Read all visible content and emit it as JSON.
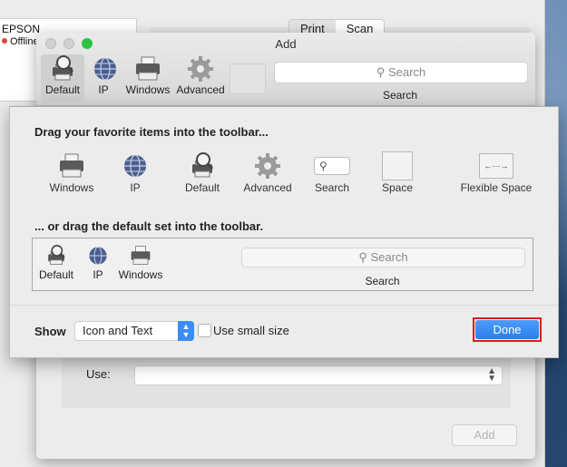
{
  "background": {
    "printer_name": "EPSON",
    "printer_status": "Offline",
    "tabs": [
      "Print",
      "Scan"
    ]
  },
  "add_window": {
    "title": "Add",
    "toolbar": [
      {
        "label": "Default",
        "icon": "default-printer-icon"
      },
      {
        "label": "IP",
        "icon": "ip-globe-icon"
      },
      {
        "label": "Windows",
        "icon": "windows-printer-icon"
      },
      {
        "label": "Advanced",
        "icon": "advanced-gear-icon"
      }
    ],
    "search_placeholder": "Search",
    "search_label": "Search",
    "use_label": "Use:",
    "add_button": "Add"
  },
  "sheet": {
    "heading_favorites": "Drag your favorite items into the toolbar...",
    "palette": [
      {
        "label": "Windows",
        "icon": "windows-printer-icon"
      },
      {
        "label": "IP",
        "icon": "ip-globe-icon"
      },
      {
        "label": "Default",
        "icon": "default-printer-icon"
      },
      {
        "label": "Advanced",
        "icon": "advanced-gear-icon"
      },
      {
        "label": "Search",
        "icon": "search-icon"
      },
      {
        "label": "Space",
        "icon": "space-icon"
      },
      {
        "label": "Flexible Space",
        "icon": "flexible-space-icon"
      }
    ],
    "heading_default": "... or drag the default set into the toolbar.",
    "default_set": [
      {
        "label": "Default",
        "icon": "default-printer-icon"
      },
      {
        "label": "IP",
        "icon": "ip-globe-icon"
      },
      {
        "label": "Windows",
        "icon": "windows-printer-icon"
      }
    ],
    "default_search_placeholder": "Search",
    "default_search_label": "Search",
    "show_label": "Show",
    "show_value": "Icon and Text",
    "small_size_label": "Use small size",
    "done_button": "Done",
    "accent_color": "#2c7ef0",
    "highlight_color": "#e21b1b"
  }
}
